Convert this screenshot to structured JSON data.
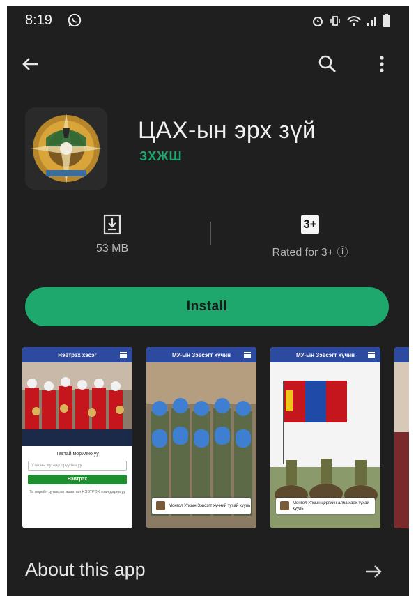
{
  "status_bar": {
    "time": "8:19",
    "icons": [
      "whatsapp-icon",
      "alarm-icon",
      "vibrate-icon",
      "wifi-icon",
      "signal-icon",
      "battery-icon"
    ]
  },
  "app_bar": {
    "icons": [
      "back-arrow-icon",
      "search-icon",
      "more-vert-icon"
    ]
  },
  "app": {
    "title": "ЦАХ-ын эрх зүй",
    "developer": "ЗХЖШ"
  },
  "stats": {
    "size_label": "53 MB",
    "rating_badge": "3+",
    "rating_label": "Rated for 3+ ⓘ"
  },
  "install": {
    "label": "Install"
  },
  "screenshots": [
    {
      "header": "Нэвтрэх хэсэг",
      "form_title": "Тавтай морилно уу",
      "field_placeholder": "Утасны дугаар оруулна уу",
      "button": "Нэвтрэх",
      "note": "Та өөрийн дугаарыг ашиглан НЭВТРЭХ товч дарна уу"
    },
    {
      "header": "МУ-ын Зэвсэгт хүчин",
      "caption": "Монгол Улсын Зэвсэгт хүчний тухай хууль"
    },
    {
      "header": "МУ-ын Зэвсэгт хүчин",
      "caption": "Монгол Улсын цэргийн алба хаах тухай хууль"
    }
  ],
  "about": {
    "title": "About this app"
  },
  "colors": {
    "accent": "#1fa86e",
    "background": "#1f1f1f",
    "screenshot_header": "#2c4aa0"
  }
}
